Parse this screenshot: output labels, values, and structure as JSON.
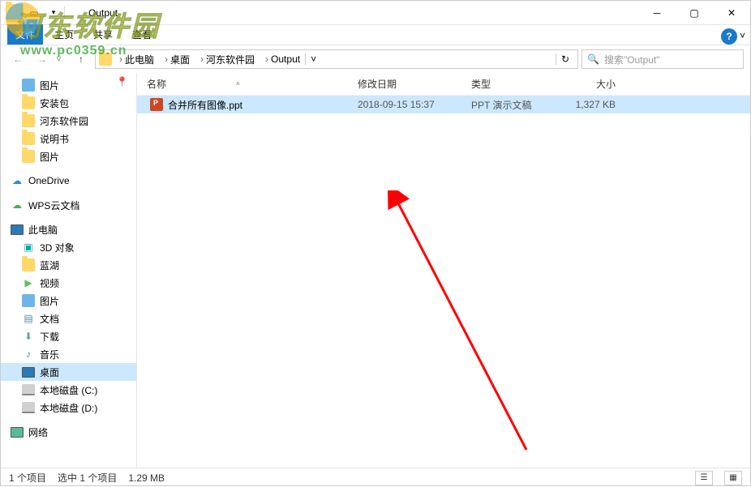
{
  "window": {
    "title": "Output",
    "ribbon": {
      "file": "文件",
      "home": "主页",
      "share": "共享",
      "view": "查看"
    }
  },
  "nav": {
    "crumbs": [
      "此电脑",
      "桌面",
      "河东软件园",
      "Output"
    ],
    "searchPlaceholder": "搜索\"Output\""
  },
  "sidebar": {
    "pin": "📌",
    "items": [
      {
        "label": "图片",
        "icon": "img",
        "level": 2
      },
      {
        "label": "安装包",
        "icon": "folder",
        "level": 2
      },
      {
        "label": "河东软件园",
        "icon": "folder",
        "level": 2
      },
      {
        "label": "说明书",
        "icon": "folder",
        "level": 2
      },
      {
        "label": "图片",
        "icon": "folder",
        "level": 2
      },
      {
        "spacer": true
      },
      {
        "label": "OneDrive",
        "icon": "cloud-blue",
        "level": 1
      },
      {
        "spacer": true
      },
      {
        "label": "WPS云文档",
        "icon": "cloud-green",
        "level": 1
      },
      {
        "spacer": true
      },
      {
        "label": "此电脑",
        "icon": "pc",
        "level": 1
      },
      {
        "label": "3D 对象",
        "icon": "3d",
        "level": 2
      },
      {
        "label": "蓝湖",
        "icon": "folder",
        "level": 2
      },
      {
        "label": "视频",
        "icon": "video",
        "level": 2
      },
      {
        "label": "图片",
        "icon": "img",
        "level": 2
      },
      {
        "label": "文档",
        "icon": "doc",
        "level": 2
      },
      {
        "label": "下载",
        "icon": "dl",
        "level": 2
      },
      {
        "label": "音乐",
        "icon": "music",
        "level": 2
      },
      {
        "label": "桌面",
        "icon": "desktop",
        "level": 2,
        "selected": true
      },
      {
        "label": "本地磁盘 (C:)",
        "icon": "drive",
        "level": 2
      },
      {
        "label": "本地磁盘 (D:)",
        "icon": "drive",
        "level": 2
      },
      {
        "spacer": true
      },
      {
        "label": "网络",
        "icon": "net",
        "level": 1
      }
    ]
  },
  "columns": {
    "name": "名称",
    "date": "修改日期",
    "type": "类型",
    "size": "大小"
  },
  "files": [
    {
      "name": "合并所有图像.ppt",
      "date": "2018-09-15 15:37",
      "type": "PPT 演示文稿",
      "size": "1,327 KB",
      "selected": true
    }
  ],
  "status": {
    "count": "1 个项目",
    "selected": "选中 1 个项目",
    "size": "1.29 MB"
  },
  "watermark": {
    "title": "河东软件园",
    "url": "www.pc0359.cn"
  }
}
